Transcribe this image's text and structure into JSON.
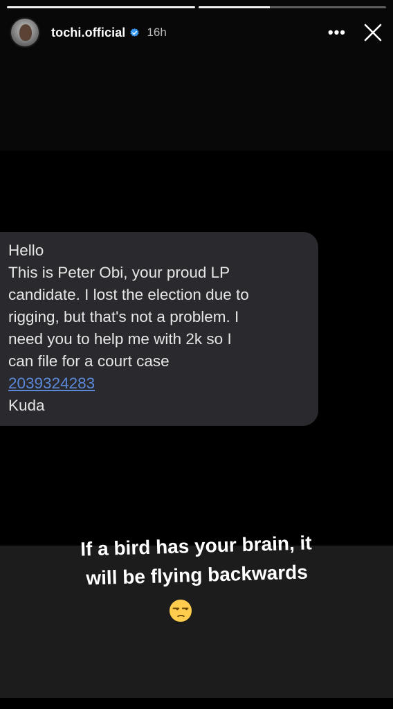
{
  "story": {
    "progress": [
      1.0,
      0.38
    ],
    "username": "tochi.official",
    "verified": true,
    "time_ago": "16h",
    "more_icon": "more-horizontal-icon",
    "close_icon": "close-icon"
  },
  "sms": {
    "lines": [
      "Hello",
      "This is Peter Obi, your proud LP",
      "candidate. I lost the election due to",
      "rigging, but that's not a problem. I",
      "need you to help me with 2k so I",
      "can file for a court case"
    ],
    "account_number": "2039324283",
    "bank": "Kuda"
  },
  "caption": {
    "line1": "If a bird has your brain, it",
    "line2": "will be flying backwards",
    "emoji": "unamused-face-emoji"
  },
  "colors": {
    "background": "#000000",
    "bubble": "#2a2a2e",
    "link": "#5b88d9",
    "caption_band": "#1c1c1c"
  }
}
